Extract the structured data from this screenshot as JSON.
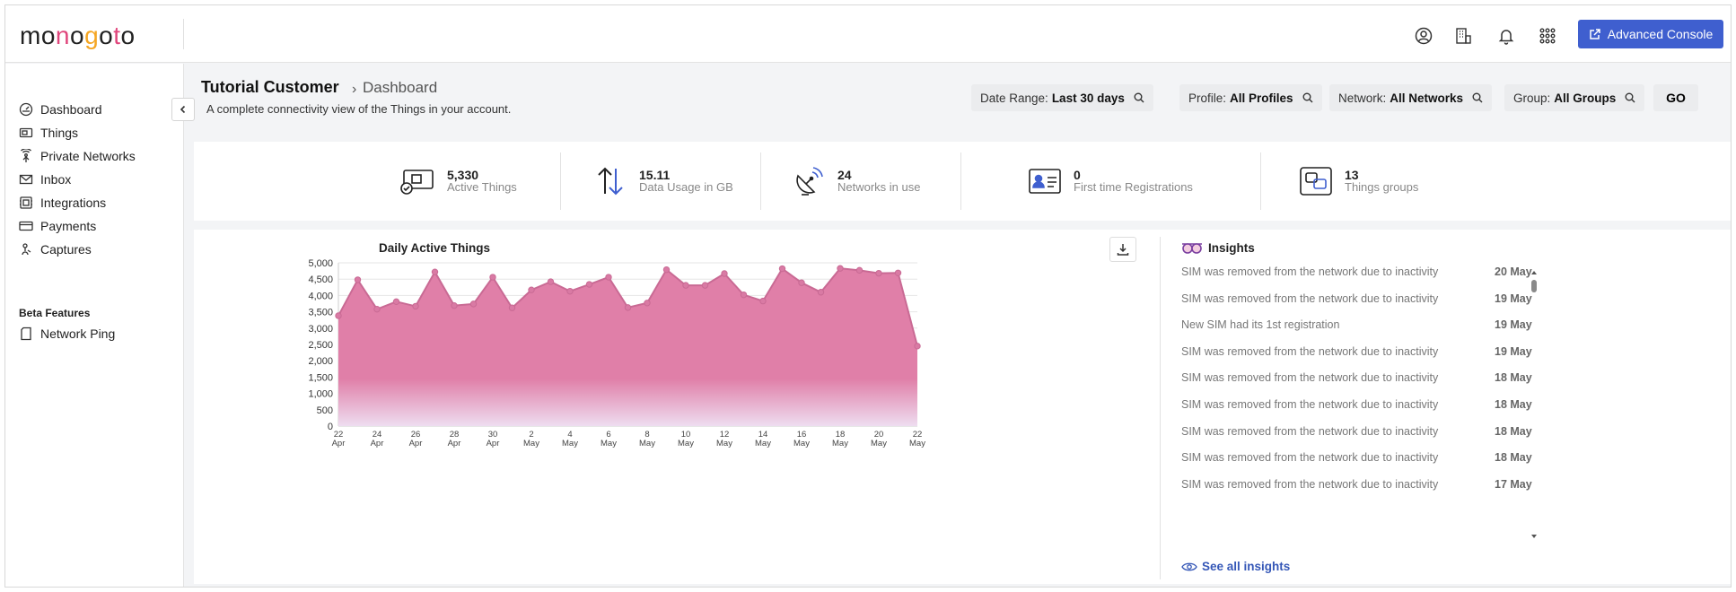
{
  "app": {
    "logo_text": "monogoto"
  },
  "topbar": {
    "icons": [
      "user-circle-icon",
      "building-icon",
      "bell-icon",
      "apps-grid-icon"
    ],
    "advanced_console_label": "Advanced Console",
    "accent": "#3f5fcf"
  },
  "sidebar": {
    "items": [
      {
        "label": "Dashboard",
        "icon": "dashboard-icon"
      },
      {
        "label": "Things",
        "icon": "sim-card-icon"
      },
      {
        "label": "Private Networks",
        "icon": "antenna-icon"
      },
      {
        "label": "Inbox",
        "icon": "envelope-icon"
      },
      {
        "label": "Integrations",
        "icon": "integrations-icon"
      },
      {
        "label": "Payments",
        "icon": "credit-card-icon"
      },
      {
        "label": "Captures",
        "icon": "captures-icon"
      }
    ],
    "beta_section_label": "Beta Features",
    "beta_items": [
      {
        "label": "Network Ping",
        "icon": "ping-icon"
      }
    ]
  },
  "header": {
    "title": "Tutorial Customer",
    "breadcrumb_sep": "›",
    "breadcrumb_current": "Dashboard",
    "subtitle": "A complete connectivity view of the Things in your account."
  },
  "filters": [
    {
      "label": "Date Range:",
      "value": "Last 30 days"
    },
    {
      "label": "Profile:",
      "value": "All Profiles"
    },
    {
      "label": "Network:",
      "value": "All Networks"
    },
    {
      "label": "Group:",
      "value": "All Groups"
    }
  ],
  "go_label": "GO",
  "stats": [
    {
      "value": "5,330",
      "label": "Active Things",
      "icon": "sim-check-icon"
    },
    {
      "value": "15.11",
      "label": "Data Usage in GB",
      "icon": "arrows-up-down-icon"
    },
    {
      "value": "24",
      "label": "Networks in use",
      "icon": "satellite-dish-icon"
    },
    {
      "value": "0",
      "label": "First time Registrations",
      "icon": "id-card-icon"
    },
    {
      "value": "13",
      "label": "Things groups",
      "icon": "groups-icon"
    }
  ],
  "chart_title": "Daily Active Things",
  "chart_data": {
    "type": "area",
    "title": "Daily Active Things",
    "xlabel": "",
    "ylabel": "",
    "ylim": [
      0,
      5000
    ],
    "yticks": [
      0,
      500,
      1000,
      1500,
      2000,
      2500,
      3000,
      3500,
      4000,
      4500,
      5000
    ],
    "ytick_labels": [
      "0",
      "500",
      "1,000",
      "1,500",
      "2,000",
      "2,500",
      "3,000",
      "3,500",
      "4,000",
      "4,500",
      "5,000"
    ],
    "xtick_labels": [
      {
        "day": "22",
        "month": "Apr"
      },
      {
        "day": "24",
        "month": "Apr"
      },
      {
        "day": "26",
        "month": "Apr"
      },
      {
        "day": "28",
        "month": "Apr"
      },
      {
        "day": "30",
        "month": "Apr"
      },
      {
        "day": "2",
        "month": "May"
      },
      {
        "day": "4",
        "month": "May"
      },
      {
        "day": "6",
        "month": "May"
      },
      {
        "day": "8",
        "month": "May"
      },
      {
        "day": "10",
        "month": "May"
      },
      {
        "day": "12",
        "month": "May"
      },
      {
        "day": "14",
        "month": "May"
      },
      {
        "day": "16",
        "month": "May"
      },
      {
        "day": "18",
        "month": "May"
      },
      {
        "day": "20",
        "month": "May"
      },
      {
        "day": "22",
        "month": "May"
      }
    ],
    "values": [
      3380,
      4480,
      3580,
      3810,
      3670,
      4720,
      3690,
      3740,
      4560,
      3620,
      4170,
      4420,
      4130,
      4340,
      4560,
      3630,
      3770,
      4790,
      4310,
      4310,
      4670,
      4020,
      3830,
      4820,
      4390,
      4100,
      4830,
      4770,
      4680,
      4690,
      2450
    ],
    "grid": true,
    "fill_color": "#e07fa8",
    "line_color": "#c96a94"
  },
  "insights": {
    "title": "Insights",
    "icon": "glasses-icon",
    "rows": [
      {
        "text": "SIM was removed from the network due to inactivity",
        "date": "20 May"
      },
      {
        "text": "SIM was removed from the network due to inactivity",
        "date": "19 May"
      },
      {
        "text": "New SIM had its 1st registration",
        "date": "19 May"
      },
      {
        "text": "SIM was removed from the network due to inactivity",
        "date": "19 May"
      },
      {
        "text": "SIM was removed from the network due to inactivity",
        "date": "18 May"
      },
      {
        "text": "SIM was removed from the network due to inactivity",
        "date": "18 May"
      },
      {
        "text": "SIM was removed from the network due to inactivity",
        "date": "18 May"
      },
      {
        "text": "SIM was removed from the network due to inactivity",
        "date": "18 May"
      },
      {
        "text": "SIM was removed from the network due to inactivity",
        "date": "17 May"
      }
    ],
    "see_all_label": "See all insights"
  }
}
